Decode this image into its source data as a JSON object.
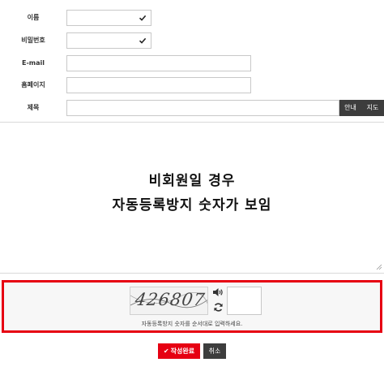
{
  "form": {
    "name_label": "이름",
    "password_label": "비밀번호",
    "email_label": "E-mail",
    "homepage_label": "홈페이지",
    "title_label": "제목",
    "guide_button": "안내",
    "map_button": "지도",
    "name_value": "",
    "password_value": "",
    "email_value": "",
    "homepage_value": "",
    "title_value": ""
  },
  "editor": {
    "notice_line1": "비회원일 경우",
    "notice_line2": "자동등록방지 숫자가 보임"
  },
  "captcha": {
    "image_text": "426807",
    "help_text": "자동등록방지 숫자를 순서대로 입력하세요.",
    "input_value": "",
    "audio_icon": "speaker-icon",
    "refresh_icon": "refresh-icon"
  },
  "actions": {
    "submit_label": "작성완료",
    "cancel_label": "취소"
  },
  "colors": {
    "accent_red": "#e60012",
    "dark_button": "#3d3d3d"
  }
}
